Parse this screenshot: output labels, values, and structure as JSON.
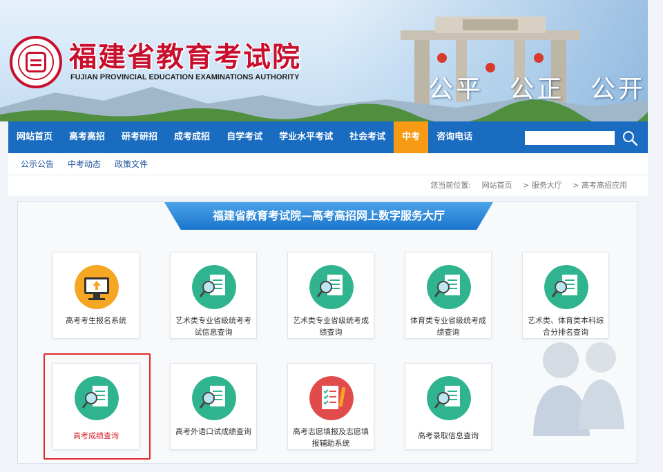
{
  "header": {
    "title_cn": "福建省教育考试院",
    "title_en": "FUJIAN PROVINCIAL EDUCATION EXAMINATIONS AUTHORITY",
    "slogan": [
      "公平",
      "公正",
      "公开"
    ]
  },
  "nav": {
    "items": [
      "网站首页",
      "高考高招",
      "研考研招",
      "成考成招",
      "自学考试",
      "学业水平考试",
      "社会考试",
      "中考",
      "咨询电话"
    ],
    "active": "中考",
    "search_value": ""
  },
  "subnav": {
    "items": [
      "公示公告",
      "中考动态",
      "政策文件"
    ]
  },
  "breadcrumb": {
    "prefix": "您当前位置:",
    "items": [
      "网站首页",
      "> 服务大厅",
      "> 高考高招应用"
    ]
  },
  "hall": {
    "title": "福建省教育考试院—高考高招网上数字服务大厅",
    "cards": [
      {
        "label": "高考考生报名系统",
        "icon": "computer-upload-icon"
      },
      {
        "label": "艺术类专业省级统考考试信息查询",
        "icon": "magnifier-report-icon"
      },
      {
        "label": "艺术类专业省级统考成绩查询",
        "icon": "magnifier-report-icon"
      },
      {
        "label": "体育类专业省级统考成绩查询",
        "icon": "magnifier-report-icon"
      },
      {
        "label": "艺术类、体育类本科综合分排名查询",
        "icon": "magnifier-report-icon"
      },
      {
        "label": "高考成绩查询",
        "icon": "magnifier-report-icon"
      },
      {
        "label": "高考外语口试成绩查询",
        "icon": "magnifier-report-icon"
      },
      {
        "label": "高考志愿填报及志愿填报辅助系统",
        "icon": "checklist-pencil-icon"
      },
      {
        "label": "高考录取信息查询",
        "icon": "magnifier-report-icon"
      }
    ]
  },
  "colors": {
    "brand_red": "#c8102e",
    "nav_blue": "#1a6cc0",
    "nav_active": "#f79a14",
    "icon_green": "#2fb48f",
    "icon_orange": "#f5a623",
    "icon_red": "#e24b4b",
    "highlight": "#e02a2a"
  }
}
